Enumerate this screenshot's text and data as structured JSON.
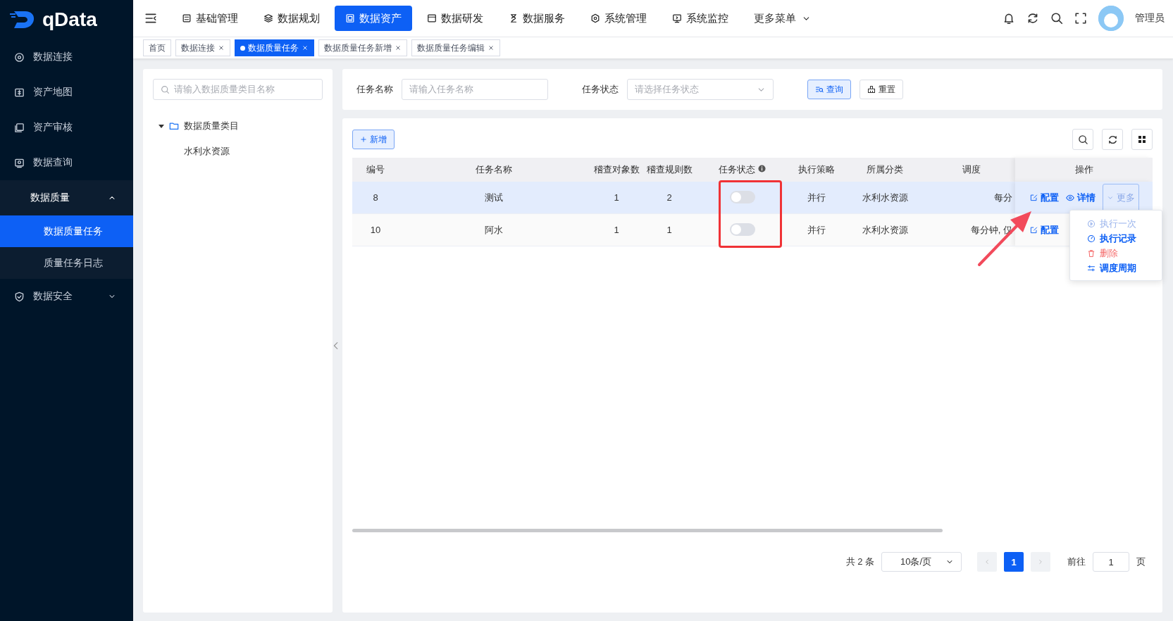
{
  "brand": {
    "name": "qData"
  },
  "top_nav": [
    {
      "label": "基础管理",
      "selected": false
    },
    {
      "label": "数据规划",
      "selected": false
    },
    {
      "label": "数据资产",
      "selected": true
    },
    {
      "label": "数据研发",
      "selected": false
    },
    {
      "label": "数据服务",
      "selected": false
    },
    {
      "label": "系统管理",
      "selected": false
    },
    {
      "label": "系统监控",
      "selected": false
    }
  ],
  "more_menu": "更多菜单",
  "user": "管理员",
  "page_tabs": [
    {
      "label": "首页",
      "selected": false,
      "closable": false
    },
    {
      "label": "数据连接",
      "selected": false,
      "closable": true
    },
    {
      "label": "数据质量任务",
      "selected": true,
      "closable": true
    },
    {
      "label": "数据质量任务新增",
      "selected": false,
      "closable": true
    },
    {
      "label": "数据质量任务编辑",
      "selected": false,
      "closable": true
    }
  ],
  "sidebar": {
    "items": [
      {
        "label": "数据连接"
      },
      {
        "label": "资产地图"
      },
      {
        "label": "资产审核"
      },
      {
        "label": "数据查询"
      },
      {
        "label": "数据质量",
        "expanded": true,
        "children": [
          {
            "label": "数据质量任务",
            "selected": true
          },
          {
            "label": "质量任务日志",
            "selected": false
          }
        ]
      },
      {
        "label": "数据安全",
        "expanded": false
      }
    ]
  },
  "category_search": {
    "placeholder": "请输入数据质量类目名称"
  },
  "category_tree": [
    {
      "label": "数据质量类目",
      "expanded": true,
      "children": [
        {
          "label": "水利水资源"
        }
      ]
    }
  ],
  "filters": [
    {
      "kind": "input",
      "label": "任务名称",
      "placeholder": "请输入任务名称"
    },
    {
      "kind": "select",
      "label": "任务状态",
      "placeholder": "请选择任务状态"
    }
  ],
  "filter_buttons": [
    {
      "kind": "search",
      "label": "查询"
    },
    {
      "kind": "reset",
      "label": "重置"
    }
  ],
  "add_button": "新增",
  "table": {
    "columns": [
      "编号",
      "任务名称",
      "稽查对象数",
      "稽查规则数",
      "任务状态",
      "执行策略",
      "所属分类",
      "调度",
      "操作"
    ],
    "rows": [
      {
        "selected": true,
        "status_on": false,
        "cells": [
          "8",
          "测试",
          "1",
          "2",
          "",
          "并行",
          "水利水资源",
          "每分"
        ],
        "actions": [
          "配置",
          "详情",
          "更多"
        ]
      },
      {
        "selected": false,
        "status_on": false,
        "cells": [
          "10",
          "阿水",
          "1",
          "1",
          "",
          "并行",
          "水利水资源",
          "每分钟, 仅"
        ],
        "actions": [
          "配置"
        ]
      }
    ]
  },
  "row_menu": [
    {
      "kind": "run",
      "label": "执行一次",
      "disabled": true
    },
    {
      "kind": "log",
      "label": "执行记录",
      "disabled": false
    },
    {
      "kind": "delete",
      "label": "删除",
      "disabled": false
    },
    {
      "kind": "schedule",
      "label": "调度周期",
      "disabled": false
    }
  ],
  "pagination": {
    "total": "共 2 条",
    "page_size": "10条/页",
    "pages": [
      {
        "label": "1",
        "selected": true
      }
    ],
    "goto_label": "前往",
    "goto_value": "1",
    "page_suffix": "页"
  }
}
